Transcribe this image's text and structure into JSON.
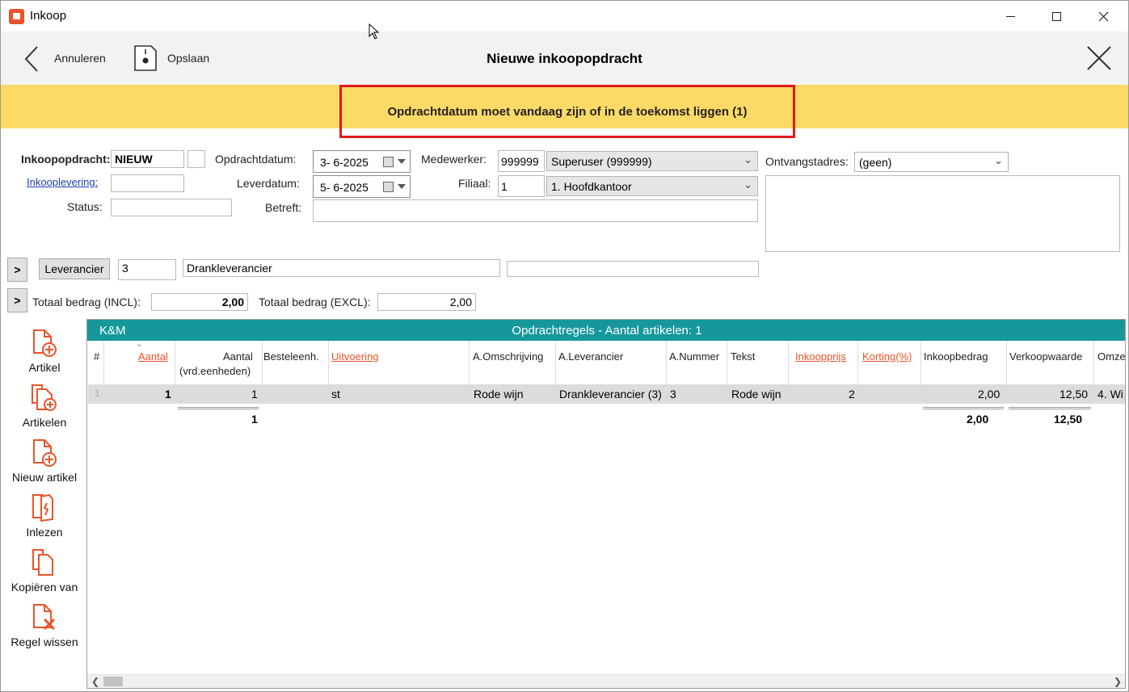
{
  "window": {
    "title": "Inkoop"
  },
  "toolbar": {
    "cancel_label": "Annuleren",
    "save_label": "Opslaan",
    "page_title": "Nieuwe inkoopopdracht"
  },
  "banner": {
    "message": "Opdrachtdatum moet vandaag zijn of in de toekomst liggen (1)"
  },
  "form": {
    "inkoopopdracht_label": "Inkoopopdracht:",
    "inkoopopdracht_value": "NIEUW",
    "inkooplevering_label": "Inkooplevering:",
    "status_label": "Status:",
    "opdrachtdatum_label": "Opdrachtdatum:",
    "opdrachtdatum_value": "3-  6-2025",
    "leverdatum_label": "Leverdatum:",
    "leverdatum_value": "5-  6-2025",
    "betreft_label": "Betreft:",
    "medewerker_label": "Medewerker:",
    "medewerker_code": "999999",
    "medewerker_name": "Superuser (999999)",
    "filiaal_label": "Filiaal:",
    "filiaal_code": "1",
    "filiaal_name": "1. Hoofdkantoor",
    "ontvangstadres_label": "Ontvangstadres:",
    "ontvangstadres_value": "(geen)",
    "expand_button": ">",
    "leverancier_button": "Leverancier",
    "leverancier_code": "3",
    "leverancier_name": "Drankleverancier",
    "totaal_incl_label": "Totaal bedrag (INCL):",
    "totaal_incl_value": "2,00",
    "totaal_excl_label": "Totaal bedrag (EXCL):",
    "totaal_excl_value": "2,00"
  },
  "sidebar": {
    "items": [
      {
        "label": "Artikel",
        "icon": "add-document-icon"
      },
      {
        "label": "Artikelen",
        "icon": "add-documents-icon"
      },
      {
        "label": "Nieuw artikel",
        "icon": "new-document-icon"
      },
      {
        "label": "Inlezen",
        "icon": "import-icon"
      },
      {
        "label": "Kopiëren van",
        "icon": "copy-icon"
      },
      {
        "label": "Regel wissen",
        "icon": "delete-row-icon"
      }
    ]
  },
  "grid": {
    "group_label": "K&M",
    "title": "Opdrachtregels - Aantal artikelen: 1",
    "columns": [
      "#",
      "Aantal",
      "Aantal",
      "(vrd.eenheden)",
      "Besteleenh.",
      "Uitvoering",
      "A.Omschrijving",
      "A.Leverancier",
      "A.Nummer",
      "Tekst",
      "Inkoopprijs",
      "Korting(%)",
      "Inkoopbedrag",
      "Verkoopwaarde",
      "Omze"
    ],
    "row": [
      "1",
      "1",
      "1",
      "",
      "st",
      "Rode wijn",
      "Drankleverancier (3)",
      "3",
      "Rode wijn",
      "2",
      "",
      "2,00",
      "12,50",
      "4. Wi"
    ],
    "totals": {
      "aantal_vrd": "1",
      "inkoopbedrag": "2,00",
      "verkoopwaarde": "12,50"
    }
  },
  "colors": {
    "accent": "#e8542a",
    "banner": "#fdd966",
    "grid_header": "#16979a",
    "error_border": "#e3191b"
  }
}
